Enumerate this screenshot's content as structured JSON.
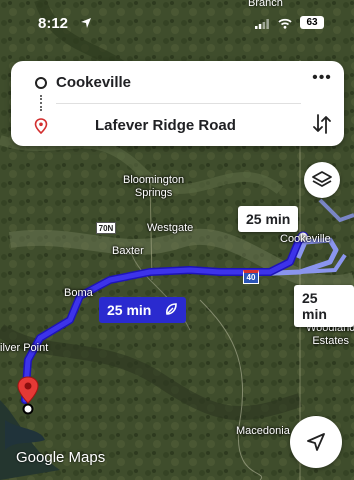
{
  "status": {
    "time": "8:12",
    "battery": "63",
    "top_label": "Branch"
  },
  "route": {
    "origin": "Cookeville",
    "destination": "Lafever Ridge Road"
  },
  "map": {
    "places": {
      "bloomington": "Bloomington\nSprings",
      "westgate": "Westgate",
      "baxter": "Baxter",
      "boma": "Boma",
      "silver_point": "ilver Point",
      "cookeville": "Cookeville",
      "woodland": "Woodland\nEstates",
      "macedonia": "Macedonia"
    },
    "shields": {
      "us70n": "70N",
      "i40": "40"
    },
    "times": {
      "selected": "25 min",
      "alt_top": "25 min",
      "alt_right": "25 min"
    }
  },
  "branding": {
    "logo": "Google Maps"
  },
  "colors": {
    "route_primary": "#2e25d8",
    "route_alt": "#9fa8f5",
    "pin": "#e53935"
  },
  "icons": [
    "location-arrow-icon",
    "signal-icon",
    "wifi-icon",
    "battery-icon",
    "more-icon",
    "swap-icon",
    "layers-icon",
    "eco-leaf-icon",
    "navigate-icon",
    "destination-pin-icon"
  ]
}
